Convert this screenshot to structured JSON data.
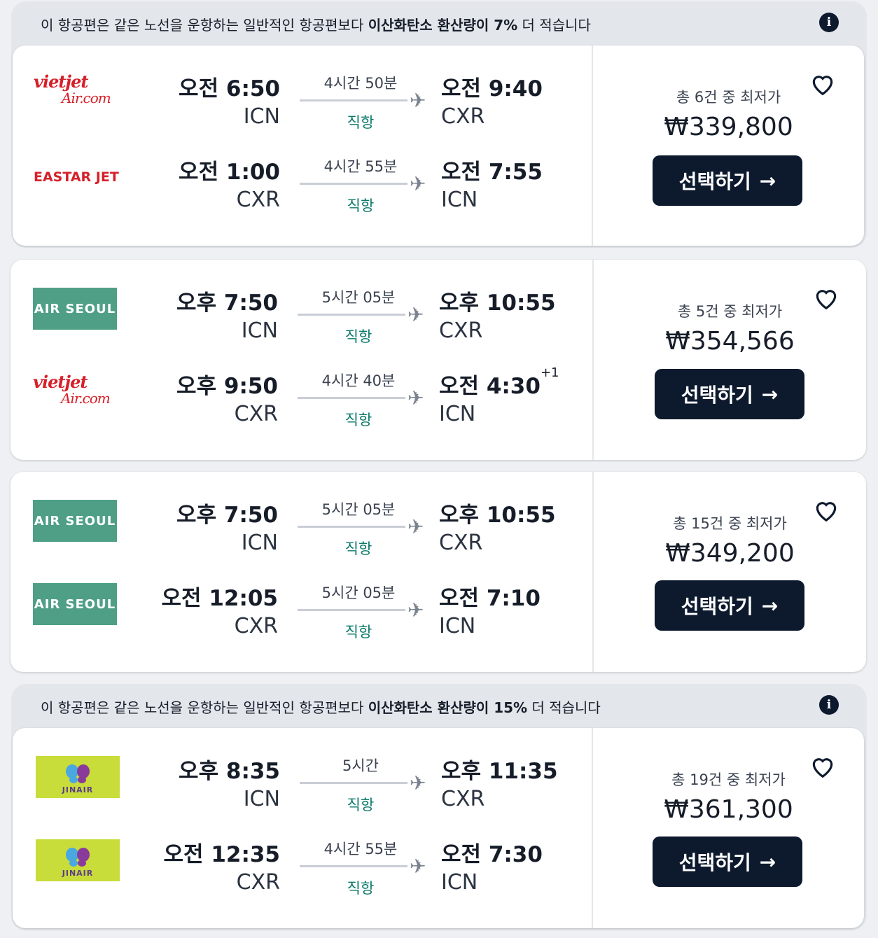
{
  "cards": [
    {
      "eco_banner": {
        "prefix": "이 항공편은 같은 노선을 운항하는 일반적인 항공편보다 ",
        "bold": "이산화탄소 환산량이 7%",
        "suffix": " 더 적습니다"
      },
      "legs": [
        {
          "airline": "vietjet",
          "dep_time": "오전 6:50",
          "dep_code": "ICN",
          "duration": "4시간 50분",
          "stops": "직항",
          "arr_time": "오전 9:40",
          "arr_suffix": "",
          "arr_code": "CXR"
        },
        {
          "airline": "eastarjet",
          "dep_time": "오전 1:00",
          "dep_code": "CXR",
          "duration": "4시간 55분",
          "stops": "직항",
          "arr_time": "오전 7:55",
          "arr_suffix": "",
          "arr_code": "ICN"
        }
      ],
      "count_label": "총 6건 중 최저가",
      "price": "₩339,800",
      "button": "선택하기"
    },
    {
      "legs": [
        {
          "airline": "airseoul",
          "dep_time": "오후 7:50",
          "dep_code": "ICN",
          "duration": "5시간 05분",
          "stops": "직항",
          "arr_time": "오후 10:55",
          "arr_suffix": "",
          "arr_code": "CXR"
        },
        {
          "airline": "vietjet",
          "dep_time": "오후 9:50",
          "dep_code": "CXR",
          "duration": "4시간 40분",
          "stops": "직항",
          "arr_time": "오전 4:30",
          "arr_suffix": "+1",
          "arr_code": "ICN"
        }
      ],
      "count_label": "총 5건 중 최저가",
      "price": "₩354,566",
      "button": "선택하기"
    },
    {
      "legs": [
        {
          "airline": "airseoul",
          "dep_time": "오후 7:50",
          "dep_code": "ICN",
          "duration": "5시간 05분",
          "stops": "직항",
          "arr_time": "오후 10:55",
          "arr_suffix": "",
          "arr_code": "CXR"
        },
        {
          "airline": "airseoul",
          "dep_time": "오전 12:05",
          "dep_code": "CXR",
          "duration": "5시간 05분",
          "stops": "직항",
          "arr_time": "오전 7:10",
          "arr_suffix": "",
          "arr_code": "ICN"
        }
      ],
      "count_label": "총 15건 중 최저가",
      "price": "₩349,200",
      "button": "선택하기"
    },
    {
      "eco_banner": {
        "prefix": "이 항공편은 같은 노선을 운항하는 일반적인 항공편보다 ",
        "bold": "이산화탄소 환산량이 15%",
        "suffix": " 더 적습니다"
      },
      "legs": [
        {
          "airline": "jinair",
          "dep_time": "오후 8:35",
          "dep_code": "ICN",
          "duration": "5시간",
          "stops": "직항",
          "arr_time": "오후 11:35",
          "arr_suffix": "",
          "arr_code": "CXR"
        },
        {
          "airline": "jinair",
          "dep_time": "오전 12:35",
          "dep_code": "CXR",
          "duration": "4시간 55분",
          "stops": "직항",
          "arr_time": "오전 7:30",
          "arr_suffix": "",
          "arr_code": "ICN"
        }
      ],
      "count_label": "총 19건 중 최저가",
      "price": "₩361,300",
      "button": "선택하기"
    }
  ],
  "logos": {
    "vietjet_line1": "vietjet",
    "vietjet_line2": "Air.com",
    "eastarjet": "EASTAR JET",
    "airseoul": "AIR SEOUL",
    "jinair": "JINAIR"
  },
  "icons": {
    "info": "info-icon",
    "heart": "heart-icon",
    "plane": "plane-icon",
    "arrow": "arrow-right-icon"
  },
  "colors": {
    "button_bg": "#0d1a2e",
    "direct_text": "#0b7a6a",
    "airseoul_green": "#4e9f86",
    "jinair_yellow": "#c8dc3a",
    "vietjet_red": "#d6202a",
    "eastar_red": "#d6202a"
  }
}
